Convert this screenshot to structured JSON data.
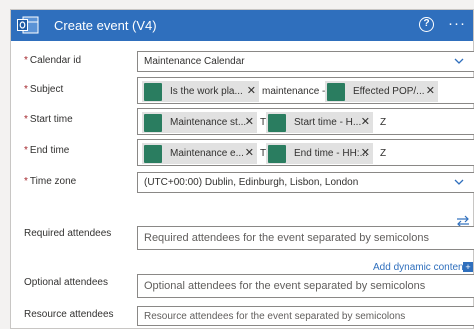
{
  "header": {
    "title": "Create event (V4)",
    "help_label": "?",
    "more_label": "···"
  },
  "fields": {
    "calendar": {
      "label": "Calendar id",
      "value": "Maintenance Calendar"
    },
    "subject": {
      "label": "Subject",
      "token1": "Is the work pla...",
      "plain": "maintenance -",
      "token2": "Effected POP/..."
    },
    "start": {
      "label": "Start time",
      "token1": "Maintenance st...",
      "sep": "T",
      "token2": "Start time - H...",
      "suffix": "Z"
    },
    "end": {
      "label": "End time",
      "token1": "Maintenance e...",
      "sep": "T",
      "token2": "End time - HH:...",
      "suffix": "Z"
    },
    "timezone": {
      "label": "Time zone",
      "value": "(UTC+00:00) Dublin, Edinburgh, Lisbon, London"
    },
    "required": {
      "label": "Required attendees",
      "placeholder": "Required attendees for the event separated by semicolons"
    },
    "optional": {
      "label": "Optional attendees",
      "placeholder": "Optional attendees for the event separated by semicolons"
    },
    "resource": {
      "label": "Resource attendees",
      "placeholder": "Resource attendees for the event separated by semicolons"
    }
  },
  "add_dynamic": {
    "label": "Add dynamic content",
    "plus": "+"
  },
  "token_close": "✕",
  "required_mark": "*",
  "colors": {
    "header": "#2f6fbd",
    "token_icon": "#2a7d60",
    "token_bg": "#e1e1e1",
    "link": "#2f6fbd"
  }
}
